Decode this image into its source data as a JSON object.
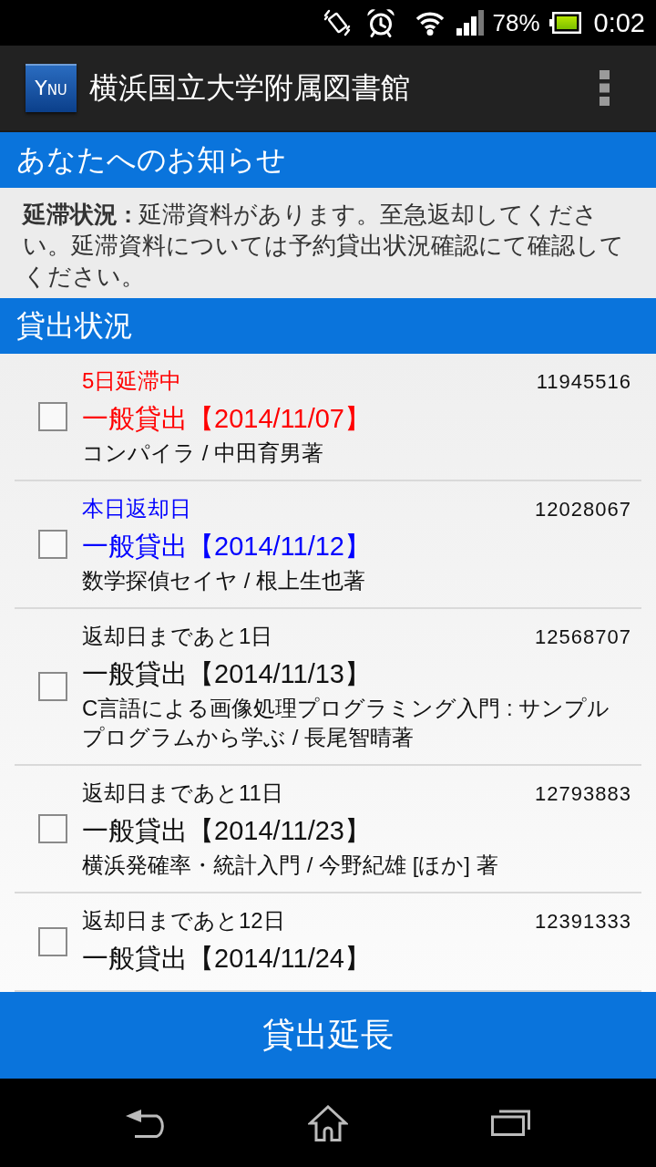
{
  "status_bar": {
    "battery": "78%",
    "time": "0:02"
  },
  "app_bar": {
    "logo": "YNU",
    "title": "横浜国立大学附属図書館"
  },
  "notices": {
    "heading": "あなたへのお知らせ",
    "text": "**延滞状況 :** 延滞資料があります。至急返却してください。延滞資料については予約貸出状況確認にて確認してください。"
  },
  "loans": {
    "heading": "貸出状況",
    "items": [
      {
        "status": "5日延滞中",
        "number": "11945516",
        "title": "一般貸出【2014/11/07】",
        "author": "コンパイラ / 中田育男著",
        "color": "#ff0000",
        "checked": false
      },
      {
        "status": "本日返却日",
        "number": "12028067",
        "title": "一般貸出【2014/11/12】",
        "author": "数学探偵セイヤ / 根上生也著",
        "color": "#0000ff",
        "checked": false
      },
      {
        "status": "返却日まであと1日",
        "number": "12568707",
        "title": "一般貸出【2014/11/13】",
        "author": "C言語による画像処理プログラミング入門 : サンプルプログラムから学ぶ / 長尾智晴著",
        "color": "#111111",
        "checked": false
      },
      {
        "status": "返却日まであと11日",
        "number": "12793883",
        "title": "一般貸出【2014/11/23】",
        "author": "横浜発確率・統計入門 / 今野紀雄 [ほか] 著",
        "color": "#111111",
        "checked": false
      },
      {
        "status": "返却日まであと12日",
        "number": "12391333",
        "title": "一般貸出【2014/11/24】",
        "color": "#111111",
        "checked": false
      }
    ]
  },
  "extend_button": "貸出延長"
}
